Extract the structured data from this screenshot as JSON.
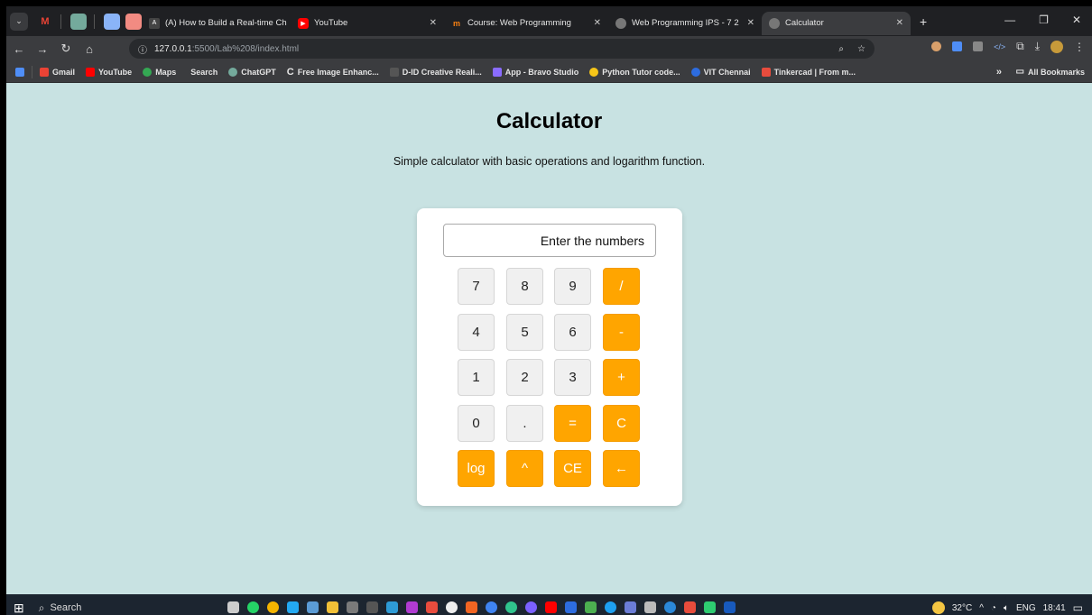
{
  "browser": {
    "tabs": [
      {
        "label": "(A) How to Build a Real-time Ch",
        "icon": "devto-icon",
        "color": "#444"
      },
      {
        "label": "YouTube",
        "icon": "youtube-icon",
        "color": "#ff0000"
      },
      {
        "label": "Course: Web Programming",
        "icon": "moodle-icon",
        "color": "#f98012"
      },
      {
        "label": "Web Programming IPS - 7 2",
        "icon": "globe-icon",
        "color": "#777"
      },
      {
        "label": "Calculator",
        "icon": "globe-icon",
        "color": "#777"
      }
    ],
    "url_host": "127.0.0.1",
    "url_path": ":5500/Lab%208/index.html",
    "bookmarks": [
      {
        "label": "Gmail",
        "color": "#ea4335"
      },
      {
        "label": "YouTube",
        "color": "#ff0000"
      },
      {
        "label": "Maps",
        "color": "#34a853"
      },
      {
        "label": "Search",
        "color": "#3b3c3f"
      },
      {
        "label": "ChatGPT",
        "color": "#74aa9c"
      },
      {
        "label": "Free Image Enhanc...",
        "color": "#ffffff"
      },
      {
        "label": "D-ID Creative Reali...",
        "color": "#555555"
      },
      {
        "label": "App - Bravo Studio",
        "color": "#8a6cff"
      },
      {
        "label": "Python Tutor code...",
        "color": "#f5c518"
      },
      {
        "label": "VIT Chennai",
        "color": "#2d6cdf"
      },
      {
        "label": "Tinkercad | From m...",
        "color": "#e84c3d"
      }
    ],
    "all_bookmarks": "All Bookmarks",
    "more": "»"
  },
  "page": {
    "title": "Calculator",
    "subtitle": "Simple calculator with basic operations and logarithm function.",
    "display_placeholder": "Enter the numbers"
  },
  "keys": {
    "k7": "7",
    "k8": "8",
    "k9": "9",
    "div": "/",
    "k4": "4",
    "k5": "5",
    "k6": "6",
    "sub": "-",
    "k1": "1",
    "k2": "2",
    "k3": "3",
    "add": "+",
    "k0": "0",
    "dot": ".",
    "eq": "=",
    "clear": "C",
    "log": "log",
    "pow": "^",
    "ce": "CE",
    "back": "←"
  },
  "taskbar": {
    "search": "Search",
    "temp": "32°C",
    "lang": "ENG",
    "time": "18:41"
  },
  "colors": {
    "accent": "#ffa500",
    "page_bg": "#c8e2e2"
  }
}
